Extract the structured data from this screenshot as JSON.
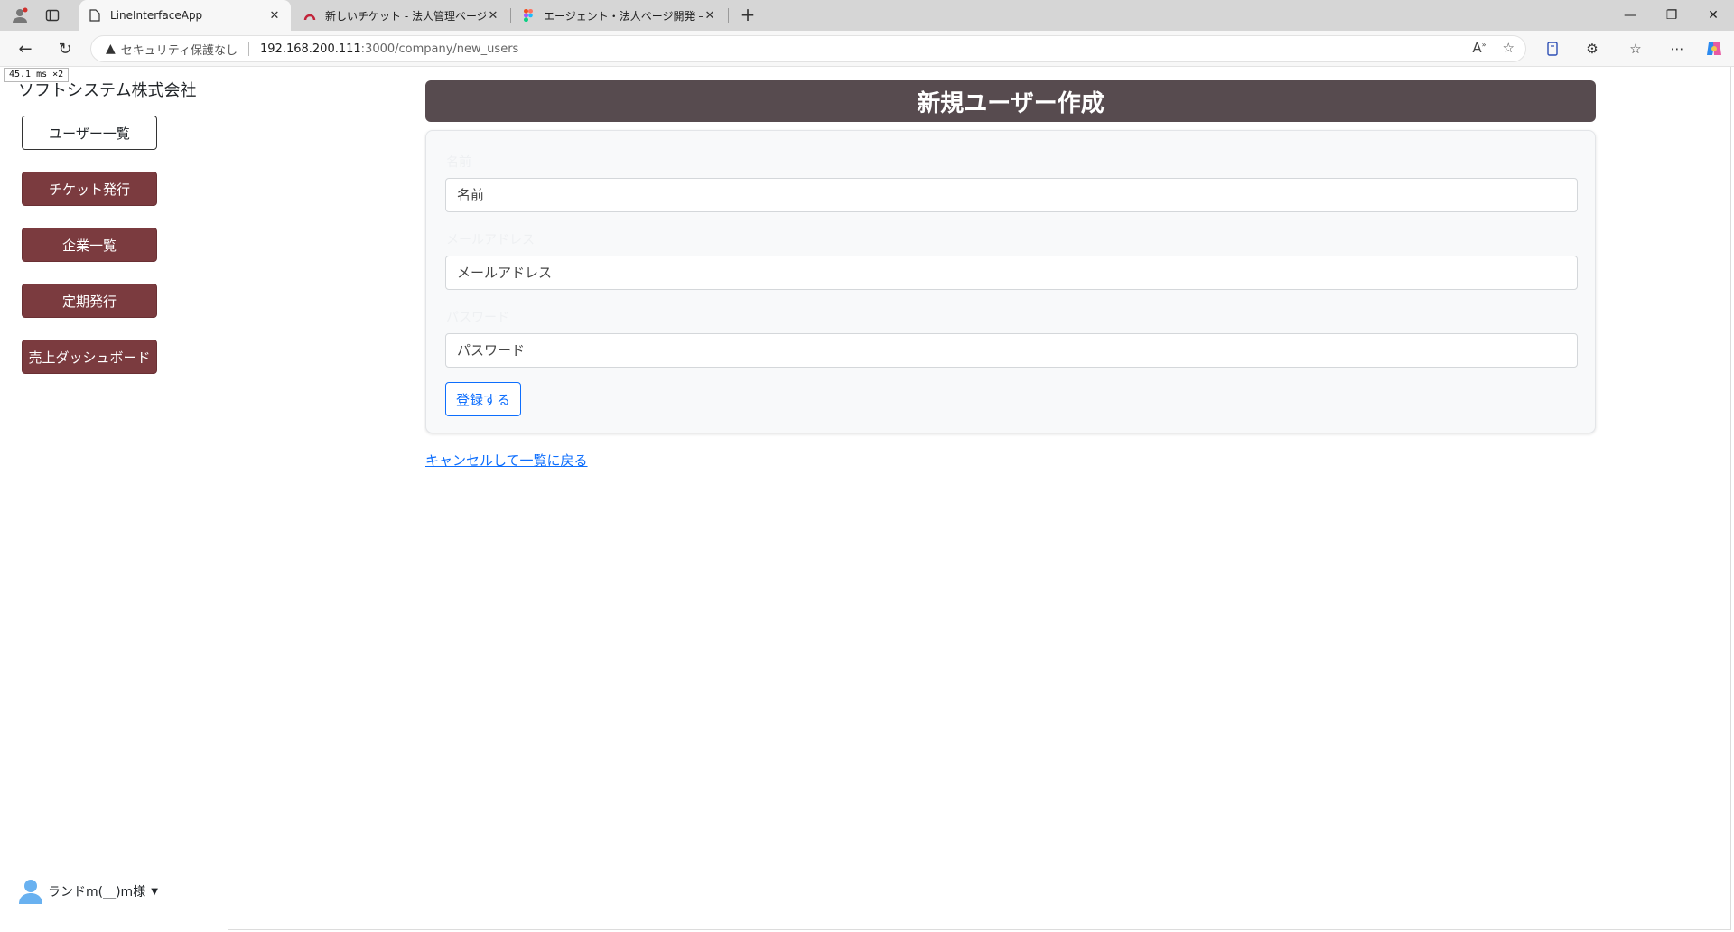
{
  "browser": {
    "tabs": [
      {
        "title": "LineInterfaceApp",
        "active": true
      },
      {
        "title": "新しいチケット - 法人管理ページ開発",
        "active": false
      },
      {
        "title": "エージェント・法人ページ開発 – Figma",
        "active": false
      }
    ],
    "address": {
      "security_label": "セキュリティ保護なし",
      "host": "192.168.200.111",
      "path": ":3000/company/new_users"
    },
    "perf_badge": "45.1 ms ×2"
  },
  "sidebar": {
    "company_name": "ソフトシステム株式会社",
    "items": [
      {
        "label": "ユーザー一覧",
        "style": "outline"
      },
      {
        "label": "チケット発行",
        "style": "filled"
      },
      {
        "label": "企業一覧",
        "style": "filled"
      },
      {
        "label": "定期発行",
        "style": "filled"
      },
      {
        "label": "売上ダッシュボード",
        "style": "filled"
      }
    ],
    "user_name": "ランドm(__)m様"
  },
  "main": {
    "title": "新規ユーザー作成",
    "form": {
      "fields": [
        {
          "label": "名前",
          "placeholder": "名前",
          "value": ""
        },
        {
          "label": "メールアドレス",
          "placeholder": "メールアドレス",
          "value": ""
        },
        {
          "label": "パスワード",
          "placeholder": "パスワード",
          "value": ""
        }
      ],
      "submit_label": "登録する"
    },
    "cancel_link": "キャンセルして一覧に戻る"
  },
  "colors": {
    "header_bg": "#574b4f",
    "sidebar_button": "#7b3b3f",
    "primary": "#0d6efd"
  }
}
